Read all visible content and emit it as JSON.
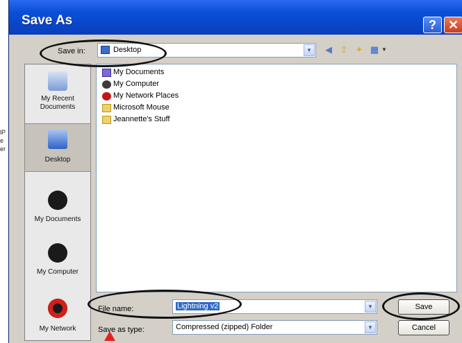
{
  "background_text": [
    "lP",
    "e",
    "er"
  ],
  "window": {
    "title": "Save As",
    "help_symbol": "?",
    "close_symbol": "✕"
  },
  "savein": {
    "label": "Save in:",
    "value": "Desktop"
  },
  "places": [
    {
      "label_line1": "My Recent",
      "label_line2": "Documents",
      "icon": "recent-documents-icon"
    },
    {
      "label_line1": "Desktop",
      "label_line2": "",
      "icon": "desktop-icon"
    },
    {
      "label_line1": "My Documents",
      "label_line2": "",
      "icon": "my-documents-icon"
    },
    {
      "label_line1": "My Computer",
      "label_line2": "",
      "icon": "my-computer-icon"
    },
    {
      "label_line1": "My Network",
      "label_line2": "",
      "icon": "my-network-icon"
    }
  ],
  "files": [
    {
      "name": "My Documents",
      "icon": "my-documents-icon"
    },
    {
      "name": "My Computer",
      "icon": "my-computer-icon"
    },
    {
      "name": "My Network Places",
      "icon": "network-places-icon"
    },
    {
      "name": "Microsoft Mouse",
      "icon": "folder-icon"
    },
    {
      "name": "Jeannette's Stuff",
      "icon": "folder-icon"
    }
  ],
  "filename": {
    "label": "File name:",
    "value": "Lightning v2"
  },
  "savetype": {
    "label": "Save as type:",
    "value": "Compressed (zipped) Folder"
  },
  "buttons": {
    "save": "Save",
    "cancel": "Cancel"
  },
  "colors": {
    "titlebar": "#0a4fd8",
    "selection": "#316ac5",
    "arrow": "#e8201a"
  }
}
